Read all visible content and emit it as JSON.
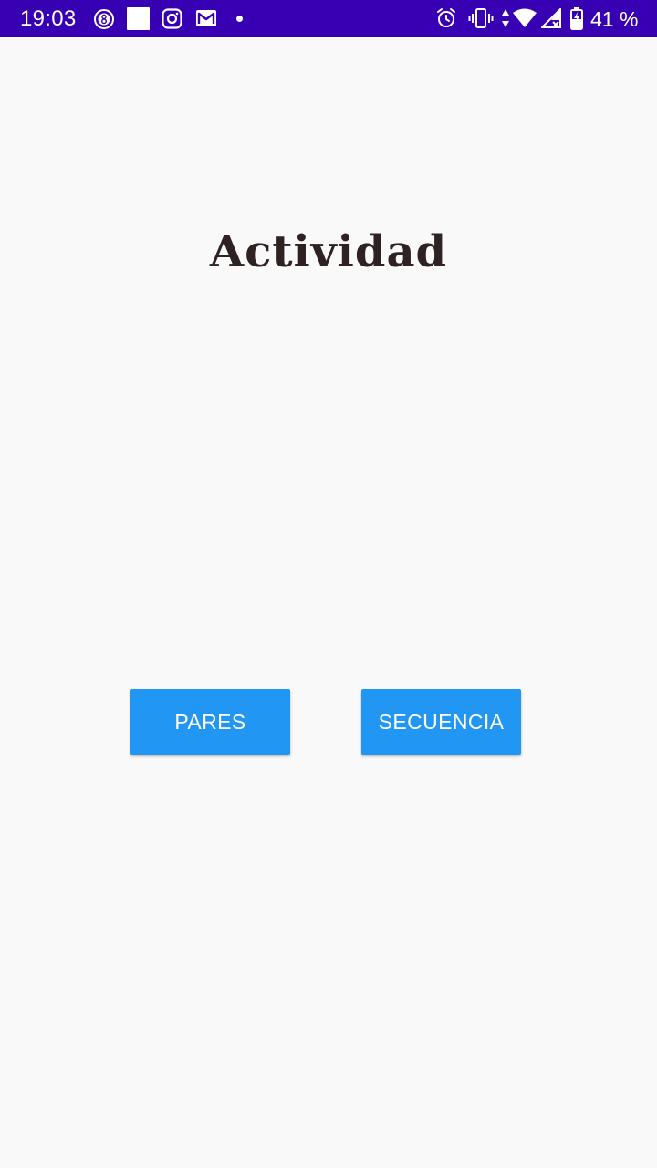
{
  "status_bar": {
    "time": "19:03",
    "battery_text": "41 %",
    "background_color": "#3700b3",
    "notification_icons": [
      "badge-8-icon",
      "blank-square-icon",
      "instagram-icon",
      "gmail-icon",
      "dot-icon"
    ],
    "system_icons": [
      "alarm-icon",
      "vibrate-icon",
      "data-arrows-icon",
      "wifi-icon",
      "signal-no-service-icon",
      "battery-icon"
    ]
  },
  "main": {
    "title": "Actividad",
    "buttons": {
      "pares_label": "PARES",
      "secuencia_label": "SECUENCIA"
    },
    "button_color": "#2196f3",
    "background_color": "#f9f9f9"
  }
}
